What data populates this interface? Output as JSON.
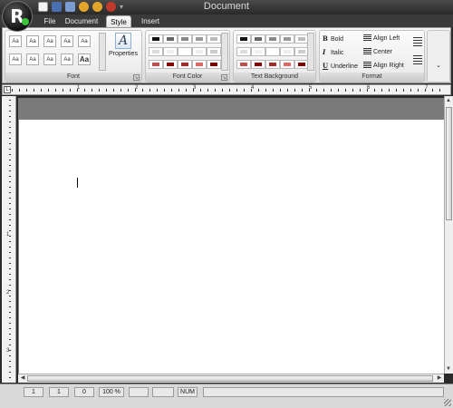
{
  "window": {
    "title": "Document"
  },
  "app": {
    "logo_letter": "R"
  },
  "tabs": [
    {
      "label": "File"
    },
    {
      "label": "Document"
    },
    {
      "label": "Style"
    },
    {
      "label": "Insert"
    }
  ],
  "ribbon": {
    "font_group": {
      "label": "Font",
      "styles": [
        "Aa",
        "Aa",
        "Aa",
        "Aa",
        "Aa",
        "Aa",
        "Aa",
        "Aa",
        "Aa",
        "Aa"
      ]
    },
    "properties_button": {
      "label": "Properties",
      "icon": "A"
    },
    "font_color_group": {
      "label": "Font Color"
    },
    "text_background_group": {
      "label": "Text Background"
    },
    "format_group": {
      "label": "Format",
      "bold": "Bold",
      "italic": "Italic",
      "underline": "Underline",
      "align_left": "Align Left",
      "center": "Center",
      "align_right": "Align Right",
      "bold_glyph": "B",
      "italic_glyph": "I",
      "underline_glyph": "U"
    }
  },
  "colors": {
    "swatches": [
      "#111111",
      "#666666",
      "#888888",
      "#999999",
      "#bbbbbb",
      "#dddddd",
      "#f0f0f0",
      "#ffffff",
      "#eeeeee",
      "#cccccc",
      "#c0504d",
      "#8b0000",
      "#a52a2a",
      "#e06666",
      "#7f0000"
    ],
    "accent": "#39c539"
  },
  "ruler": {
    "numbers": [
      "1",
      "2",
      "3",
      "4",
      "5",
      "6",
      "7"
    ],
    "v_numbers": [
      "1",
      "2",
      "3"
    ]
  },
  "statusbar": {
    "line": "1",
    "column": "1",
    "position": "0",
    "zoom": "100 %",
    "mode": "NUM"
  }
}
